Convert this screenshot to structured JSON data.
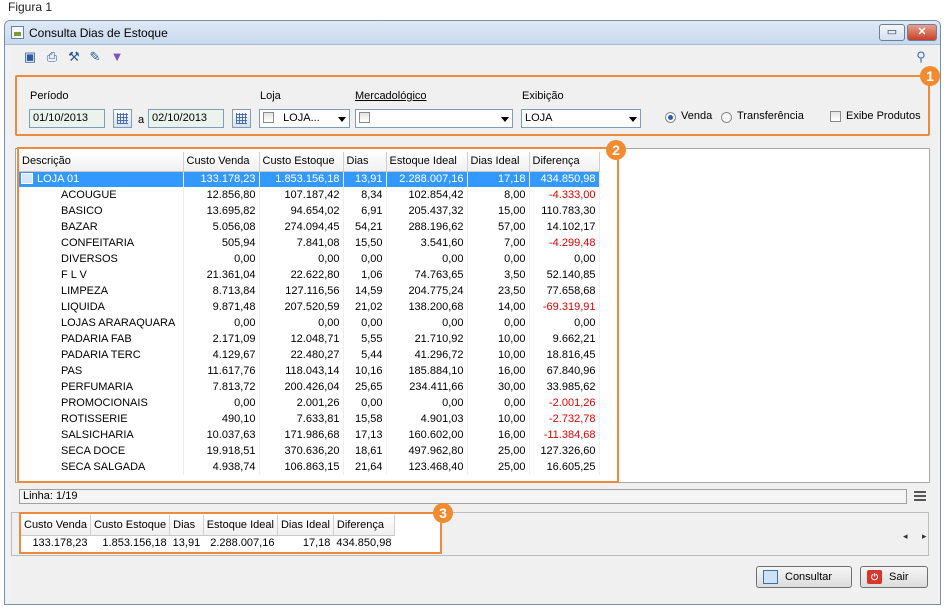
{
  "figure_label": "Figura 1",
  "window": {
    "title": "Consulta Dias de Estoque",
    "restore_label": "▭",
    "close_label": "✕"
  },
  "toolbar": {
    "icons": [
      "search-icon",
      "print-icon",
      "tools-icon",
      "export-icon",
      "filter-icon"
    ],
    "right_icon": "key-icon"
  },
  "filters": {
    "periodo_label": "Período",
    "date_from": "01/10/2013",
    "date_sep": "a",
    "date_to": "02/10/2013",
    "loja_label": "Loja",
    "loja_value": "LOJA...",
    "mercadologico_label": "Mercadológico",
    "mercadologico_value": "",
    "exibicao_label": "Exibição",
    "exibicao_value": "LOJA",
    "radio_venda": "Venda",
    "radio_transferencia": "Transferência",
    "exibe_produtos": "Exibe Produtos"
  },
  "badges": [
    "1",
    "2",
    "3"
  ],
  "grid": {
    "columns": [
      "Descrição",
      "Custo Venda",
      "Custo Estoque",
      "Dias",
      "Estoque Ideal",
      "Dias Ideal",
      "Diferença"
    ],
    "rows": [
      {
        "desc": "LOJA 01",
        "custo_venda": "133.178,23",
        "custo_estoque": "1.853.156,18",
        "dias": "13,91",
        "estoque_ideal": "2.288.007,16",
        "dias_ideal": "17,18",
        "diferenca": "434.850,98",
        "neg": false,
        "selected": true
      },
      {
        "desc": "ACOUGUE",
        "custo_venda": "12.856,80",
        "custo_estoque": "107.187,42",
        "dias": "8,34",
        "estoque_ideal": "102.854,42",
        "dias_ideal": "8,00",
        "diferenca": "-4.333,00",
        "neg": true
      },
      {
        "desc": "BASICO",
        "custo_venda": "13.695,82",
        "custo_estoque": "94.654,02",
        "dias": "6,91",
        "estoque_ideal": "205.437,32",
        "dias_ideal": "15,00",
        "diferenca": "110.783,30",
        "neg": false
      },
      {
        "desc": "BAZAR",
        "custo_venda": "5.056,08",
        "custo_estoque": "274.094,45",
        "dias": "54,21",
        "estoque_ideal": "288.196,62",
        "dias_ideal": "57,00",
        "diferenca": "14.102,17",
        "neg": false
      },
      {
        "desc": "CONFEITARIA",
        "custo_venda": "505,94",
        "custo_estoque": "7.841,08",
        "dias": "15,50",
        "estoque_ideal": "3.541,60",
        "dias_ideal": "7,00",
        "diferenca": "-4.299,48",
        "neg": true
      },
      {
        "desc": "DIVERSOS",
        "custo_venda": "0,00",
        "custo_estoque": "0,00",
        "dias": "0,00",
        "estoque_ideal": "0,00",
        "dias_ideal": "0,00",
        "diferenca": "0,00",
        "neg": false
      },
      {
        "desc": "F L V",
        "custo_venda": "21.361,04",
        "custo_estoque": "22.622,80",
        "dias": "1,06",
        "estoque_ideal": "74.763,65",
        "dias_ideal": "3,50",
        "diferenca": "52.140,85",
        "neg": false
      },
      {
        "desc": "LIMPEZA",
        "custo_venda": "8.713,84",
        "custo_estoque": "127.116,56",
        "dias": "14,59",
        "estoque_ideal": "204.775,24",
        "dias_ideal": "23,50",
        "diferenca": "77.658,68",
        "neg": false
      },
      {
        "desc": "LIQUIDA",
        "custo_venda": "9.871,48",
        "custo_estoque": "207.520,59",
        "dias": "21,02",
        "estoque_ideal": "138.200,68",
        "dias_ideal": "14,00",
        "diferenca": "-69.319,91",
        "neg": true
      },
      {
        "desc": "LOJAS ARARAQUARA",
        "custo_venda": "0,00",
        "custo_estoque": "0,00",
        "dias": "0,00",
        "estoque_ideal": "0,00",
        "dias_ideal": "0,00",
        "diferenca": "0,00",
        "neg": false
      },
      {
        "desc": "PADARIA FAB",
        "custo_venda": "2.171,09",
        "custo_estoque": "12.048,71",
        "dias": "5,55",
        "estoque_ideal": "21.710,92",
        "dias_ideal": "10,00",
        "diferenca": "9.662,21",
        "neg": false
      },
      {
        "desc": "PADARIA TERC",
        "custo_venda": "4.129,67",
        "custo_estoque": "22.480,27",
        "dias": "5,44",
        "estoque_ideal": "41.296,72",
        "dias_ideal": "10,00",
        "diferenca": "18.816,45",
        "neg": false
      },
      {
        "desc": "PAS",
        "custo_venda": "11.617,76",
        "custo_estoque": "118.043,14",
        "dias": "10,16",
        "estoque_ideal": "185.884,10",
        "dias_ideal": "16,00",
        "diferenca": "67.840,96",
        "neg": false
      },
      {
        "desc": "PERFUMARIA",
        "custo_venda": "7.813,72",
        "custo_estoque": "200.426,04",
        "dias": "25,65",
        "estoque_ideal": "234.411,66",
        "dias_ideal": "30,00",
        "diferenca": "33.985,62",
        "neg": false
      },
      {
        "desc": "PROMOCIONAIS",
        "custo_venda": "0,00",
        "custo_estoque": "2.001,26",
        "dias": "0,00",
        "estoque_ideal": "0,00",
        "dias_ideal": "0,00",
        "diferenca": "-2.001,26",
        "neg": true
      },
      {
        "desc": "ROTISSERIE",
        "custo_venda": "490,10",
        "custo_estoque": "7.633,81",
        "dias": "15,58",
        "estoque_ideal": "4.901,03",
        "dias_ideal": "10,00",
        "diferenca": "-2.732,78",
        "neg": true
      },
      {
        "desc": "SALSICHARIA",
        "custo_venda": "10.037,63",
        "custo_estoque": "171.986,68",
        "dias": "17,13",
        "estoque_ideal": "160.602,00",
        "dias_ideal": "16,00",
        "diferenca": "-11.384,68",
        "neg": true
      },
      {
        "desc": "SECA DOCE",
        "custo_venda": "19.918,51",
        "custo_estoque": "370.636,20",
        "dias": "18,61",
        "estoque_ideal": "497.962,80",
        "dias_ideal": "25,00",
        "diferenca": "127.326,60",
        "neg": false
      },
      {
        "desc": "SECA SALGADA",
        "custo_venda": "4.938,74",
        "custo_estoque": "106.863,15",
        "dias": "21,64",
        "estoque_ideal": "123.468,40",
        "dias_ideal": "25,00",
        "diferenca": "16.605,25",
        "neg": false
      }
    ]
  },
  "status": {
    "linha": "Linha: 1/19"
  },
  "summary": {
    "columns": [
      "Custo Venda",
      "Custo Estoque",
      "Dias",
      "Estoque Ideal",
      "Dias Ideal",
      "Diferença"
    ],
    "values": [
      "133.178,23",
      "1.853.156,18",
      "13,91",
      "2.288.007,16",
      "17,18",
      "434.850,98"
    ]
  },
  "nav": "◂ ▸",
  "buttons": {
    "consultar": "Consultar",
    "sair": "Sair"
  }
}
